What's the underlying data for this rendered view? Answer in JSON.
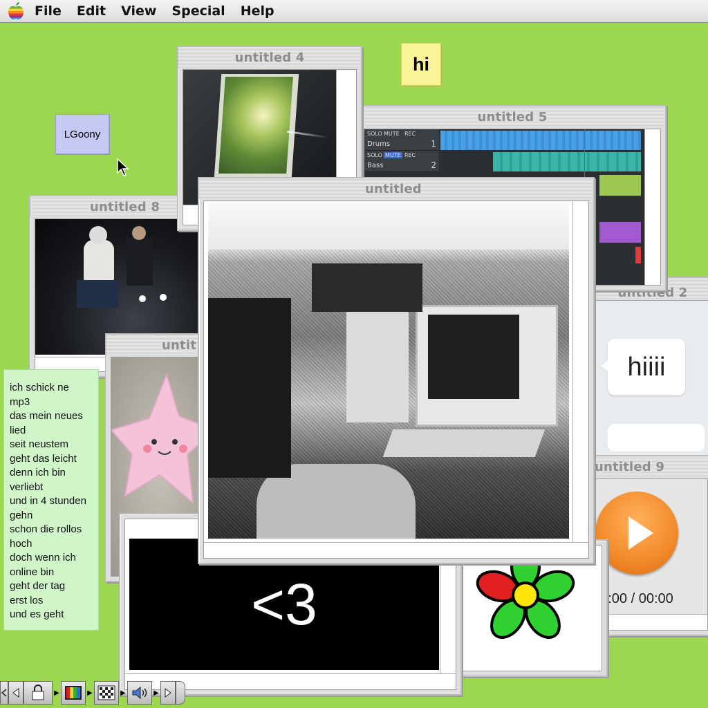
{
  "menubar": {
    "items": [
      "File",
      "Edit",
      "View",
      "Special",
      "Help"
    ]
  },
  "notes": {
    "hi": "hi",
    "lgoony": "LGoony",
    "lyrics": [
      "ich schick ne",
      "mp3",
      "das mein neues",
      "lied",
      "seit neustem",
      "geht das leicht",
      "denn ich bin",
      "verliebt",
      "und in 4 stunden",
      "gehn",
      "schon die rollos",
      "hoch",
      "doch wenn ich",
      "online bin",
      "geht der tag",
      "erst los",
      "und es geht"
    ]
  },
  "windows": {
    "w4": {
      "title": "untitled 4"
    },
    "w5": {
      "title": "untitled 5",
      "tracks": [
        {
          "buttons": [
            "SOLO",
            "MUTE",
            "REC"
          ],
          "name": "Drums",
          "num": "1"
        },
        {
          "buttons": [
            "SOLO",
            "MUTE",
            "REC"
          ],
          "name": "Bass",
          "num": "2"
        }
      ]
    },
    "w8": {
      "title": "untitled 8"
    },
    "wmain": {
      "title": "untitled"
    },
    "w2": {
      "title": "untitled 2",
      "bubble": "hiiii"
    },
    "w9": {
      "title": "untitled 9",
      "time": "00:00 / 00:00"
    },
    "wheart": {
      "text": "<3"
    },
    "wstar": {
      "title": "untit"
    }
  },
  "colors": {
    "desktop": "#9bd84f",
    "play_orange": "#f28a2a",
    "icq_green": "#2fd02f",
    "icq_red": "#e02020"
  }
}
